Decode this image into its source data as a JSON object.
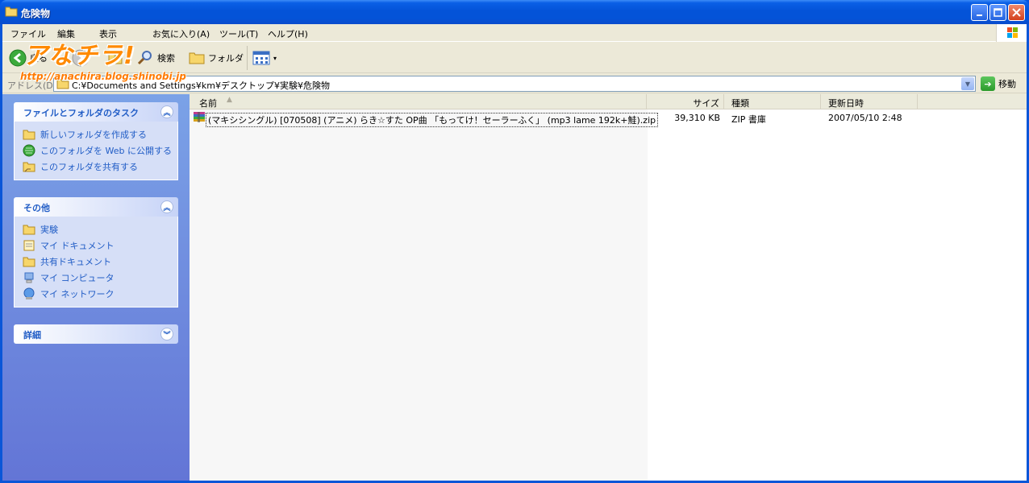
{
  "window": {
    "title": "危険物",
    "controls": [
      "minimize",
      "maximize",
      "close"
    ]
  },
  "menubar": {
    "items": [
      "ファイル",
      "編集",
      "表示",
      "お気に入り(A)",
      "ツール(T)",
      "ヘルプ(H)"
    ]
  },
  "toolbar": {
    "back_label": "戻る",
    "search_label": "検索",
    "folders_label": "フォルダ"
  },
  "watermark": {
    "logo": "アなチラ!",
    "url": "http://anachira.blog.shinobi.jp"
  },
  "address": {
    "label": "アドレス(D)",
    "value": "C:¥Documents and Settings¥km¥デスクトップ¥実験¥危険物",
    "go_label": "移動"
  },
  "taskpane": {
    "panels": [
      {
        "title": "ファイルとフォルダのタスク",
        "items": [
          "新しいフォルダを作成する",
          "このフォルダを Web に公開する",
          "このフォルダを共有する"
        ]
      },
      {
        "title": "その他",
        "items": [
          "実験",
          "マイ ドキュメント",
          "共有ドキュメント",
          "マイ コンピュータ",
          "マイ ネットワーク"
        ]
      },
      {
        "title": "詳細",
        "items": []
      }
    ]
  },
  "filelist": {
    "columns": [
      "名前",
      "サイズ",
      "種類",
      "更新日時"
    ],
    "rows": [
      {
        "name": "(マキシシングル) [070508] (アニメ) らき☆すた OP曲 「もってけ！セーラーふく」 (mp3 lame 192k+鮭).zip",
        "size": "39,310 KB",
        "type": "ZIP 書庫",
        "modified": "2007/05/10 2:48"
      }
    ]
  },
  "colors": {
    "titlebar": "#0453d8",
    "taskpane_link": "#215dc6",
    "watermark": "#ff8a00"
  }
}
